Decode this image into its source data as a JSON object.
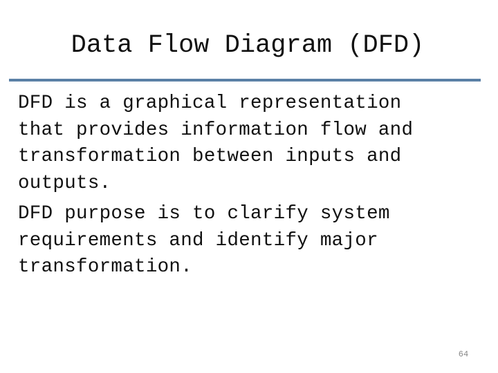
{
  "slide": {
    "title": "Data Flow Diagram (DFD)",
    "paragraphs": [
      "DFD is a graphical representation\nthat provides information flow and\ntransformation between inputs and\noutputs.",
      "DFD purpose is to clarify system\nrequirements and identify major\ntransformation."
    ],
    "page_number": "64",
    "colors": {
      "rule": "#5a80a6",
      "text": "#111111",
      "page_number": "#8a8a8a"
    }
  }
}
